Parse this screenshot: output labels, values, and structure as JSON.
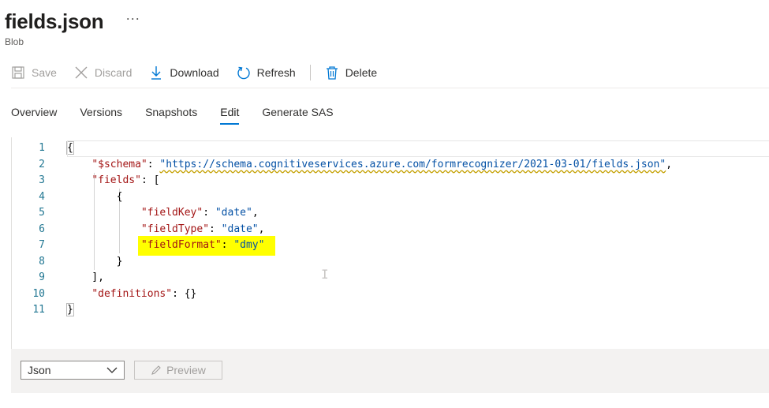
{
  "header": {
    "title": "fields.json",
    "more": "···",
    "subtitle": "Blob"
  },
  "toolbar": {
    "save": "Save",
    "discard": "Discard",
    "download": "Download",
    "refresh": "Refresh",
    "delete": "Delete"
  },
  "tabs": [
    {
      "label": "Overview"
    },
    {
      "label": "Versions"
    },
    {
      "label": "Snapshots"
    },
    {
      "label": "Edit",
      "active": true
    },
    {
      "label": "Generate SAS"
    }
  ],
  "editor": {
    "line_numbers": [
      "1",
      "2",
      "3",
      "4",
      "5",
      "6",
      "7",
      "8",
      "9",
      "10",
      "11"
    ],
    "code": {
      "schema_key": "\"$schema\"",
      "schema_url": "\"https://schema.cognitiveservices.azure.com/formrecognizer/2021-03-01/fields.json\"",
      "fields_key": "\"fields\"",
      "fieldkey_key": "\"fieldKey\"",
      "fieldkey_val": "\"date\"",
      "fieldtype_key": "\"fieldType\"",
      "fieldtype_val": "\"date\"",
      "fieldformat_key": "\"fieldFormat\"",
      "fieldformat_val": "\"dmy\"",
      "definitions_key": "\"definitions\""
    },
    "highlight_color": "#ffff00"
  },
  "footer": {
    "language": "Json",
    "preview": "Preview"
  },
  "colors": {
    "accent": "#0078d4",
    "json_key": "#a31515",
    "json_string": "#0451a5",
    "line_number": "#237893"
  }
}
